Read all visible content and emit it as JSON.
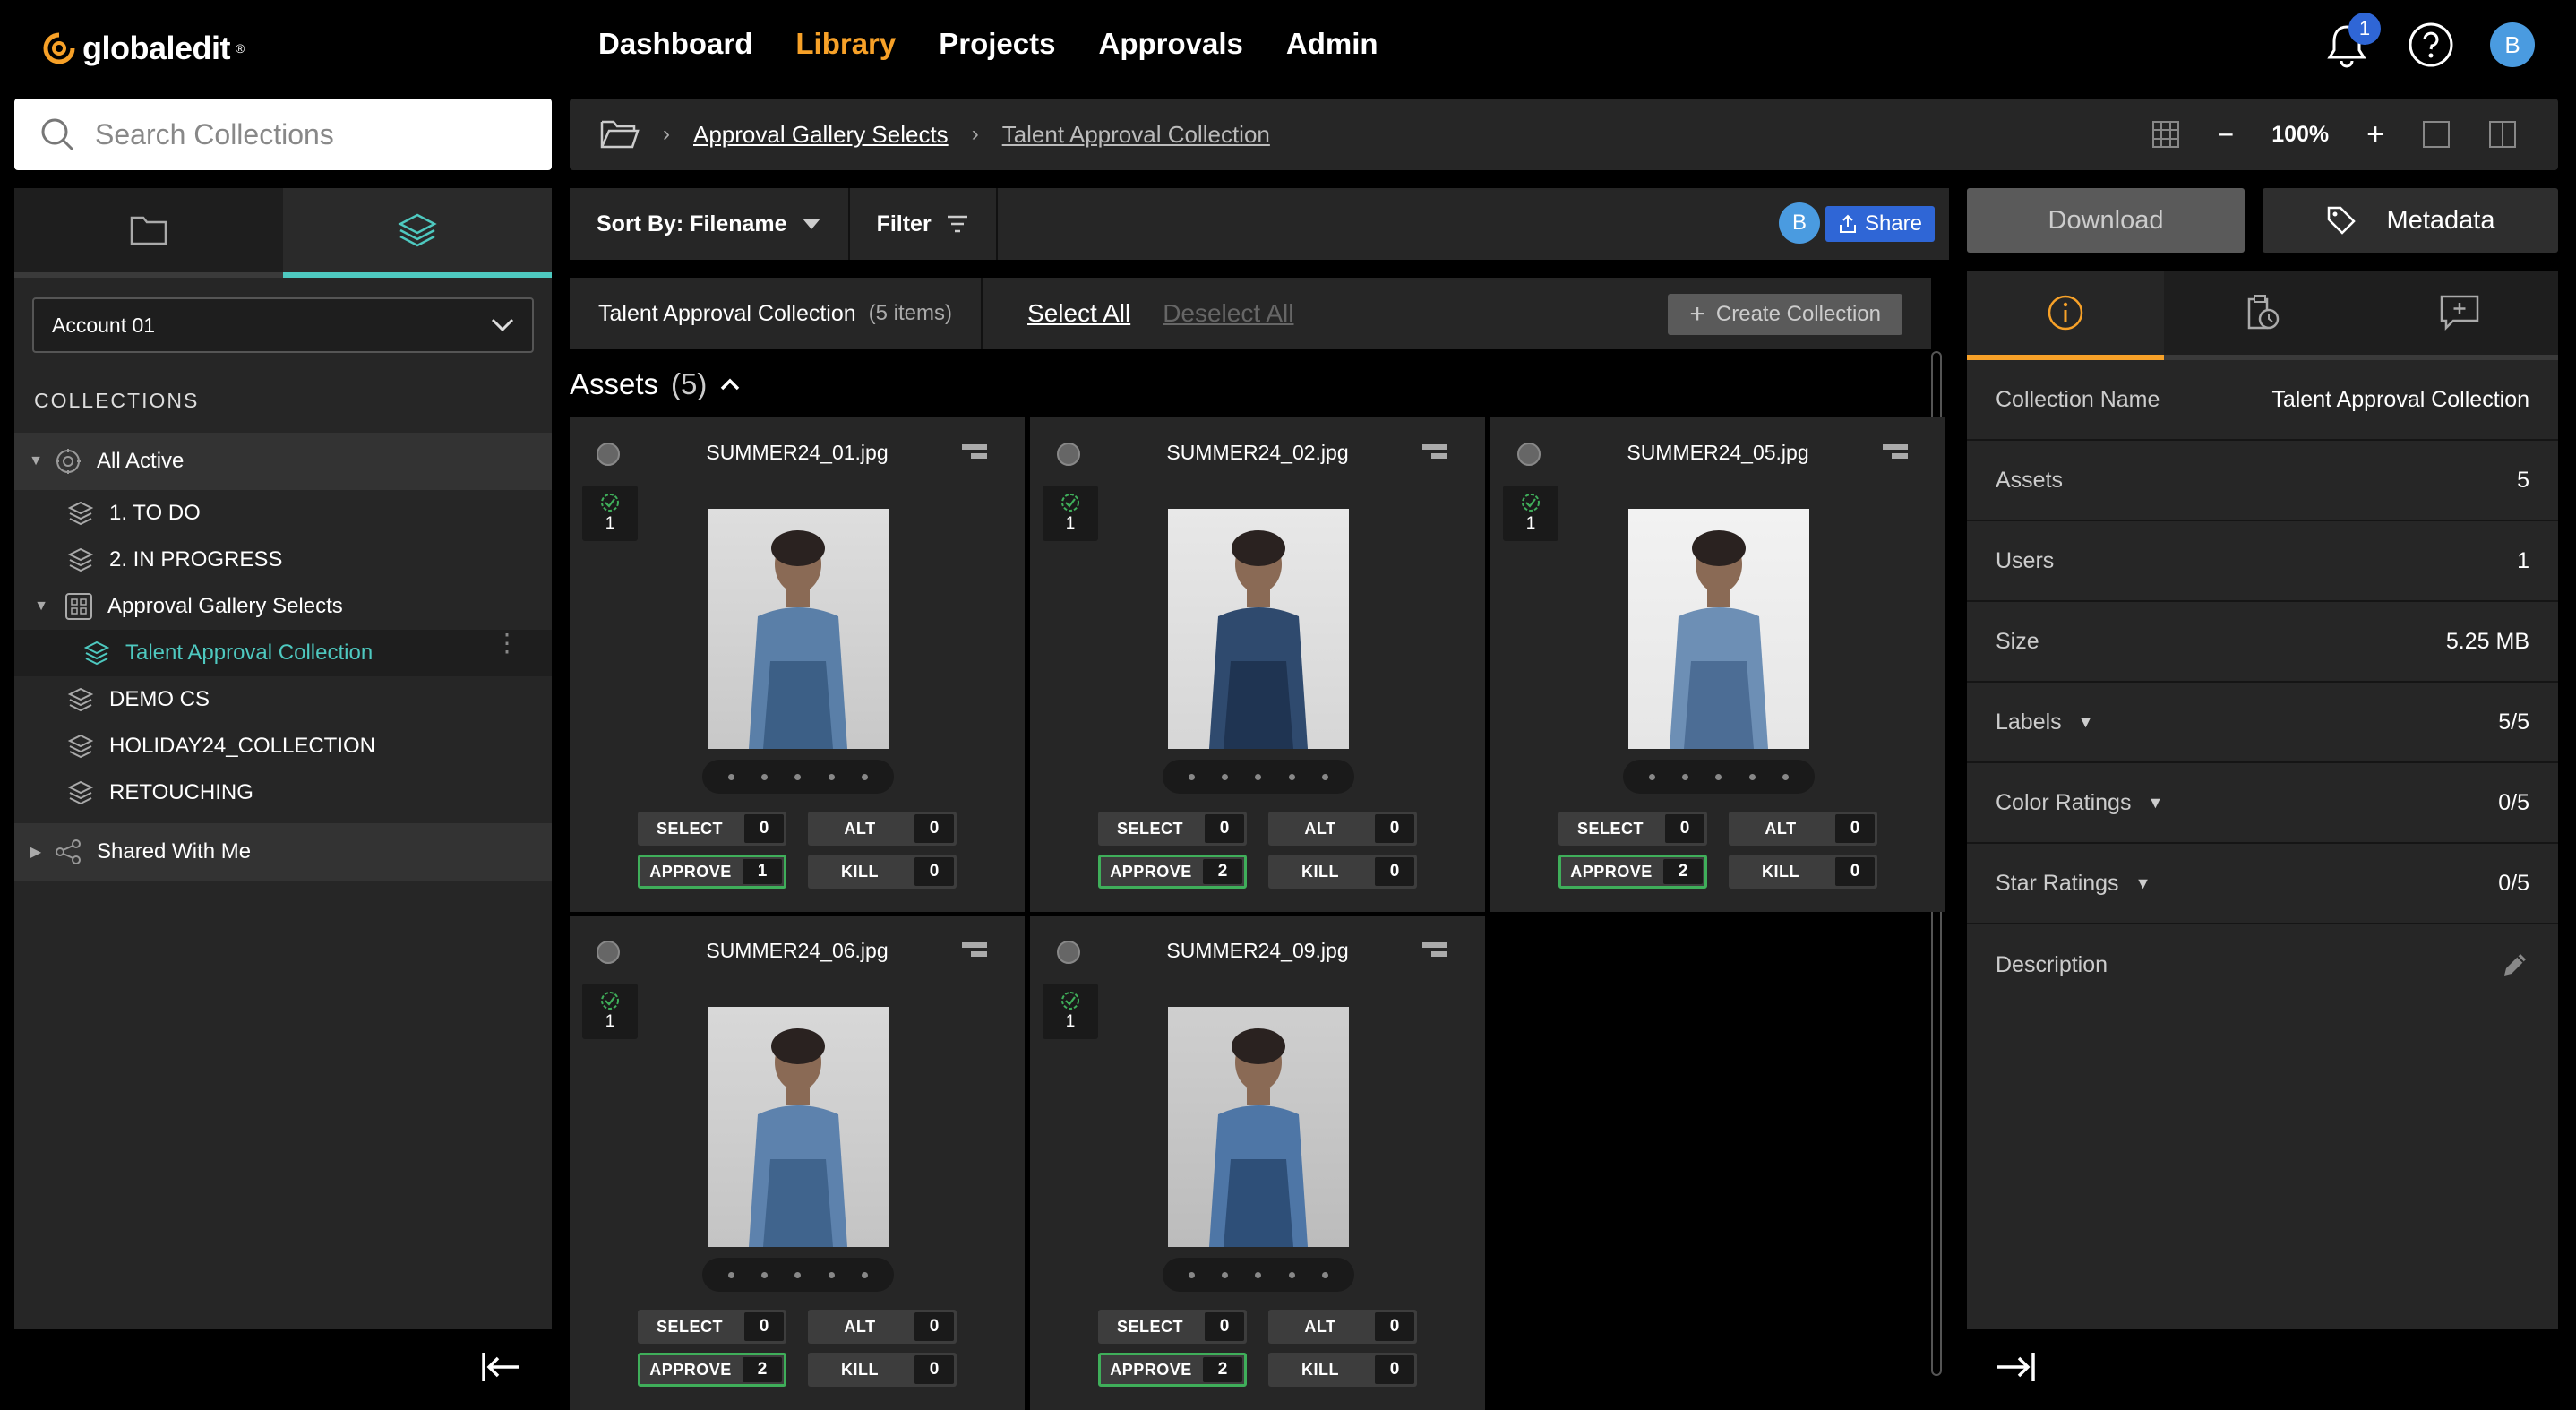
{
  "app": {
    "logo_text": "globaledit",
    "logo_trademark": "®"
  },
  "nav": {
    "items": [
      {
        "label": "Dashboard"
      },
      {
        "label": "Library"
      },
      {
        "label": "Projects"
      },
      {
        "label": "Approvals"
      },
      {
        "label": "Admin"
      }
    ],
    "active": "Library",
    "notification_count": "1",
    "user_initial": "B"
  },
  "colors": {
    "accent": "#f7a128",
    "teal": "#4ec9c0",
    "approve_green": "#3fae5a",
    "share_blue": "#2f66d6"
  },
  "sidebar": {
    "search_placeholder": "Search Collections",
    "account": "Account 01",
    "collections_heading": "COLLECTIONS",
    "tree": [
      {
        "label": "All Active",
        "icon": "all-active-icon",
        "kind": "group"
      },
      {
        "label": "1. TO DO",
        "icon": "stack-icon"
      },
      {
        "label": "2. IN PROGRESS",
        "icon": "stack-icon"
      },
      {
        "label": "Approval Gallery Selects",
        "icon": "gallery-icon"
      },
      {
        "label": "Talent Approval Collection",
        "icon": "layers-icon",
        "selected": true
      },
      {
        "label": "DEMO CS",
        "icon": "layers-icon"
      },
      {
        "label": "HOLIDAY24_COLLECTION",
        "icon": "layers-icon"
      },
      {
        "label": "RETOUCHING",
        "icon": "layers-icon"
      },
      {
        "label": "Shared With Me",
        "icon": "share-nodes-icon",
        "kind": "group"
      }
    ]
  },
  "breadcrumb": {
    "items": [
      "Approval Gallery Selects",
      "Talent Approval Collection"
    ],
    "zoom": "100%"
  },
  "toolbar": {
    "sort_label": "Sort By: Filename",
    "filter_label": "Filter",
    "share_label": "Share",
    "user_initial": "B"
  },
  "collection": {
    "title": "Talent Approval Collection",
    "count": "(5 items)",
    "select_all": "Select All",
    "deselect_all": "Deselect All",
    "create_label": "Create Collection"
  },
  "assets": {
    "heading": "Assets",
    "count": "(5)",
    "cards": [
      {
        "filename": "SUMMER24_01.jpg",
        "version": "1",
        "select": "0",
        "alt": "0",
        "approve": "1",
        "kill": "0"
      },
      {
        "filename": "SUMMER24_02.jpg",
        "version": "1",
        "select": "0",
        "alt": "0",
        "approve": "2",
        "kill": "0"
      },
      {
        "filename": "SUMMER24_05.jpg",
        "version": "1",
        "select": "0",
        "alt": "0",
        "approve": "2",
        "kill": "0"
      },
      {
        "filename": "SUMMER24_06.jpg",
        "version": "1",
        "select": "0",
        "alt": "0",
        "approve": "2",
        "kill": "0"
      },
      {
        "filename": "SUMMER24_09.jpg",
        "version": "1",
        "select": "0",
        "alt": "0",
        "approve": "2",
        "kill": "0"
      }
    ],
    "labels": {
      "select": "SELECT",
      "alt": "ALT",
      "approve": "APPROVE",
      "kill": "KILL"
    }
  },
  "right_panel": {
    "download_label": "Download",
    "metadata_label": "Metadata",
    "info": [
      {
        "key": "Collection Name",
        "value": "Talent Approval Collection"
      },
      {
        "key": "Assets",
        "value": "5"
      },
      {
        "key": "Users",
        "value": "1"
      },
      {
        "key": "Size",
        "value": "5.25 MB"
      },
      {
        "key": "Labels",
        "value": "5/5",
        "dropdown": true
      },
      {
        "key": "Color Ratings",
        "value": "0/5",
        "dropdown": true
      },
      {
        "key": "Star Ratings",
        "value": "0/5",
        "dropdown": true
      },
      {
        "key": "Description",
        "value": "",
        "edit": true
      }
    ]
  }
}
